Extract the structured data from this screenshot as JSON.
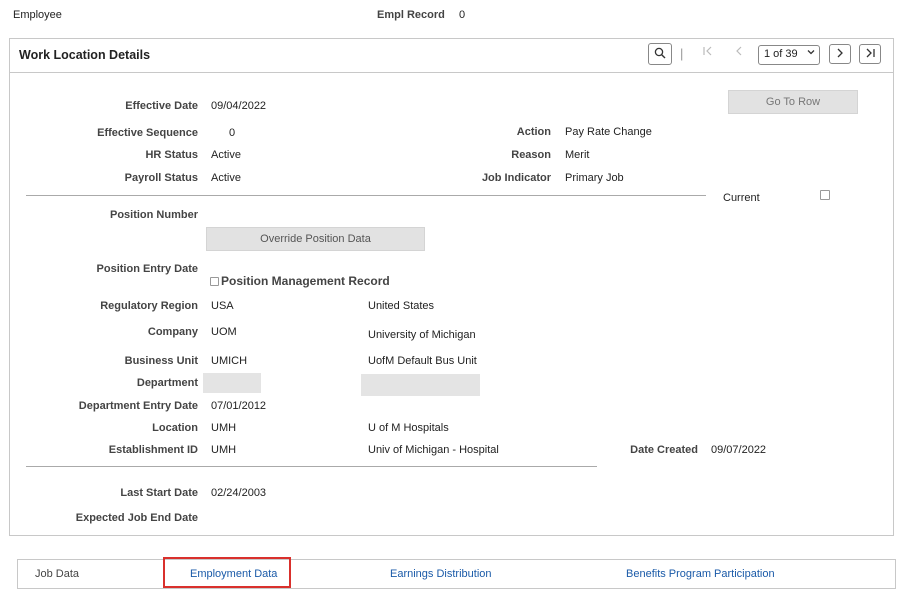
{
  "header": {
    "employee_label": "Employee",
    "empl_record_label": "Empl Record",
    "empl_record_value": "0"
  },
  "panel": {
    "title": "Work Location Details",
    "pager": {
      "separator": "|",
      "selected": "1 of 39"
    },
    "go_to_row": "Go To Row"
  },
  "fields": {
    "effective_date": {
      "label": "Effective Date",
      "value": "09/04/2022"
    },
    "effective_sequence": {
      "label": "Effective Sequence",
      "value": "0"
    },
    "hr_status": {
      "label": "HR Status",
      "value": "Active"
    },
    "payroll_status": {
      "label": "Payroll Status",
      "value": "Active"
    },
    "action": {
      "label": "Action",
      "value": "Pay Rate Change"
    },
    "reason": {
      "label": "Reason",
      "value": "Merit"
    },
    "job_indicator": {
      "label": "Job Indicator",
      "value": "Primary Job"
    },
    "current": {
      "label": "Current"
    },
    "position_number": {
      "label": "Position Number"
    },
    "override_position_data": "Override Position Data",
    "position_entry_date": {
      "label": "Position Entry Date"
    },
    "position_management_record": "Position Management Record",
    "regulatory_region": {
      "label": "Regulatory Region",
      "value": "USA",
      "desc": "United States"
    },
    "company": {
      "label": "Company",
      "value": "UOM",
      "desc": "University of Michigan"
    },
    "business_unit": {
      "label": "Business Unit",
      "value": "UMICH",
      "desc": "UofM Default Bus Unit"
    },
    "department": {
      "label": "Department"
    },
    "department_entry_date": {
      "label": "Department Entry Date",
      "value": "07/01/2012"
    },
    "location": {
      "label": "Location",
      "value": "UMH",
      "desc": "U of M Hospitals"
    },
    "establishment_id": {
      "label": "Establishment ID",
      "value": "UMH",
      "desc": "Univ of Michigan - Hospital"
    },
    "date_created": {
      "label": "Date Created",
      "value": "09/07/2022"
    },
    "last_start_date": {
      "label": "Last Start Date",
      "value": "02/24/2003"
    },
    "expected_job_end_date": {
      "label": "Expected Job End Date"
    }
  },
  "tabs": [
    {
      "label": "Job Data"
    },
    {
      "label": "Employment Data"
    },
    {
      "label": "Earnings Distribution"
    },
    {
      "label": "Benefits Program Participation"
    }
  ],
  "colors": {
    "link": "#1a5aa8",
    "highlight": "#d9302c"
  },
  "icons": [
    "search-icon",
    "first-page-icon",
    "previous-icon",
    "chevron-down-icon",
    "next-icon",
    "last-page-icon"
  ]
}
